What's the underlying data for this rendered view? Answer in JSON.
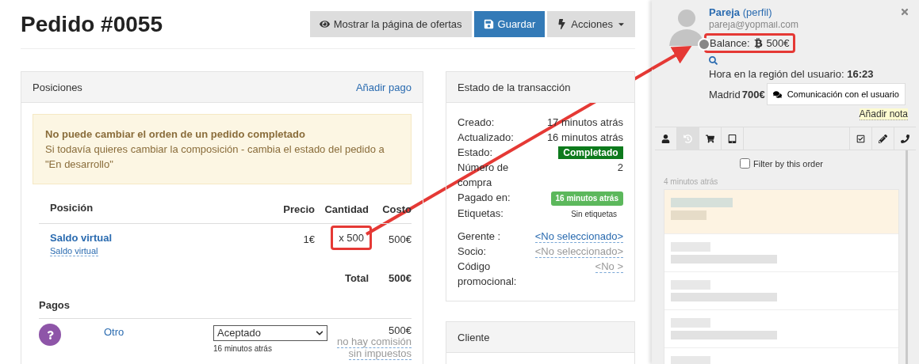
{
  "page": {
    "title": "Pedido #0055"
  },
  "toolbar": [
    {
      "kind": "default",
      "label": "Mostrar la página de ofertas"
    },
    {
      "kind": "primary",
      "label": "Guardar"
    },
    {
      "kind": "dropdown",
      "label": "Acciones"
    }
  ],
  "positions_card": {
    "title": "Posiciones",
    "action": "Añadir pago",
    "alert": {
      "title": "No puede cambiar el orden de un pedido completado",
      "text": "Si todavía quieres cambiar la composición - cambia el estado del pedido a \"En desarrollo\""
    },
    "columns": [
      "Posición",
      "Precio",
      "Cantidad",
      "Costo"
    ],
    "items": [
      {
        "name": "Saldo virtual",
        "subtitle": "Saldo virtual",
        "price": "1€",
        "quantity": "x 500",
        "quantity_highlighted": true,
        "cost": "500€"
      }
    ],
    "total_label": "Total",
    "total": "500€",
    "payments_title": "Pagos",
    "payments": [
      {
        "method": "Otro",
        "status": "Aceptado",
        "time": "16 minutos atrás",
        "amount": "500€",
        "commission": "no hay comisión",
        "tax": "sin impuestos"
      }
    ]
  },
  "transaction_card": {
    "title": "Estado de la transacción",
    "rows": [
      {
        "label": "Creado:",
        "kind": "text",
        "value": "17 minutos atrás"
      },
      {
        "label": "Actualizado:",
        "kind": "text",
        "value": "16 minutos atrás"
      },
      {
        "label": "Estado:",
        "kind": "status",
        "value": "Completado"
      },
      {
        "label": "Número de compra",
        "kind": "text",
        "value": "2"
      },
      {
        "label": "Pagado en:",
        "kind": "badge",
        "value": "16 minutos atrás"
      },
      {
        "label": "Etiquetas:",
        "kind": "small",
        "value": "Sin etiquetas"
      },
      {
        "label": "Gerente :",
        "kind": "link",
        "value": "<No seleccionado>"
      },
      {
        "label": "Socio:",
        "kind": "muted-link",
        "value": "<No seleccionado>"
      },
      {
        "label": "Código promocional:",
        "kind": "muted-link",
        "value": "<No >"
      }
    ]
  },
  "client_card": {
    "title": "Cliente"
  },
  "user_panel": {
    "name": "Pareja",
    "profile_link": "(perfil)",
    "email": "pareja@yopmail.com",
    "balance_label": "Balance:",
    "balance": "500€",
    "balance_highlighted": true,
    "online": false,
    "time_label": "Hora en la región del usuario:",
    "time": "16:23",
    "city": "Madrid",
    "city_amount": "700€",
    "contact_button": "Comunicación con el usuario",
    "note_link": "Añadir nota",
    "tabs": [
      {
        "selected": false
      },
      {
        "selected": true
      },
      {
        "selected": false
      },
      {
        "selected": false
      },
      {
        "selected": false
      },
      {
        "selected": false
      },
      {
        "selected": false
      }
    ],
    "filter": {
      "label": "Filter by this order",
      "checked": false
    },
    "history_time": "4 minutos atrás",
    "history_entries": [
      {
        "kind": "highlighted"
      },
      {
        "kind": "plain"
      },
      {
        "kind": "plain"
      },
      {
        "kind": "plain"
      },
      {
        "kind": "plain"
      }
    ]
  },
  "callout": {
    "kind": "arrow"
  }
}
